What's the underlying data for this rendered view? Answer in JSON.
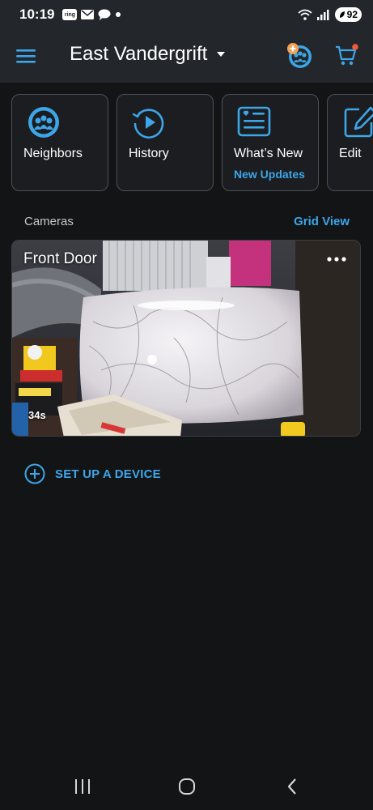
{
  "status_bar": {
    "time": "10:19",
    "ring_badge": "ring",
    "battery": "92"
  },
  "header": {
    "location": "East Vandergrift",
    "icons": [
      "menu-icon",
      "caret-down-icon",
      "neighbors-avatar-icon",
      "cart-icon"
    ]
  },
  "tiles": [
    {
      "label": "Neighbors",
      "sub": "",
      "icon": "neighbors-icon"
    },
    {
      "label": "History",
      "sub": "",
      "icon": "history-icon"
    },
    {
      "label": "What’s New",
      "sub": "New Updates",
      "icon": "news-icon"
    },
    {
      "label": "Edit",
      "sub": "",
      "icon": "edit-icon"
    }
  ],
  "cameras": {
    "title": "Cameras",
    "grid_view": "Grid View",
    "items": [
      {
        "name": "Front Door",
        "age": "34s",
        "icon": "more-options-icon"
      }
    ]
  },
  "setup": {
    "label": "SET UP A DEVICE",
    "icon": "plus-circle-icon"
  },
  "colors": {
    "accent": "#3da6e8",
    "background": "#131416",
    "header": "#23272c",
    "notification_dot": "#f15a3a"
  }
}
